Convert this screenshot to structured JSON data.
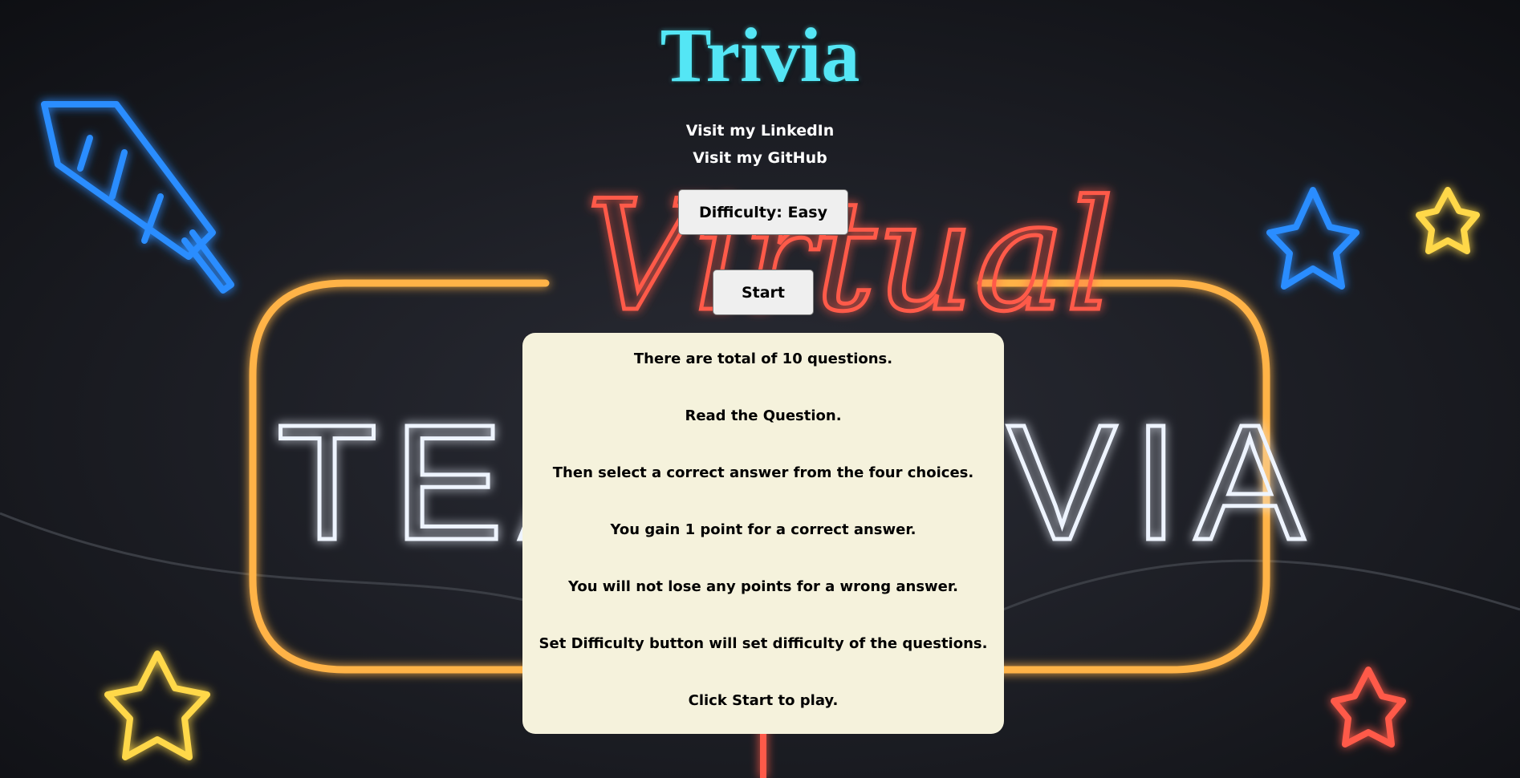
{
  "page": {
    "title": "Trivia",
    "links": {
      "linkedin": "Visit my LinkedIn",
      "github": "Visit my GitHub"
    },
    "difficulty_button": "Difficulty: Easy",
    "start_button": "Start",
    "instructions": [
      "There are total of 10 questions.",
      "Read the Question.",
      "Then select a correct answer from the four choices.",
      "You gain 1 point for a correct answer.",
      "You will not lose any points for a wrong answer.",
      "Set Difficulty button will set difficulty of the questions.",
      "Click Start to play."
    ]
  },
  "background": {
    "sign_text_left": "TEA",
    "sign_text_right": "VIA",
    "script_text": "Virtual",
    "colors": {
      "title": "#54e6f5",
      "panel": "#f5f2dc",
      "neon_orange": "#ffb347",
      "neon_red": "#ff5a4a",
      "neon_blue": "#2a8dff",
      "neon_yellow": "#ffd84a",
      "neon_white": "#eef4ff"
    }
  }
}
